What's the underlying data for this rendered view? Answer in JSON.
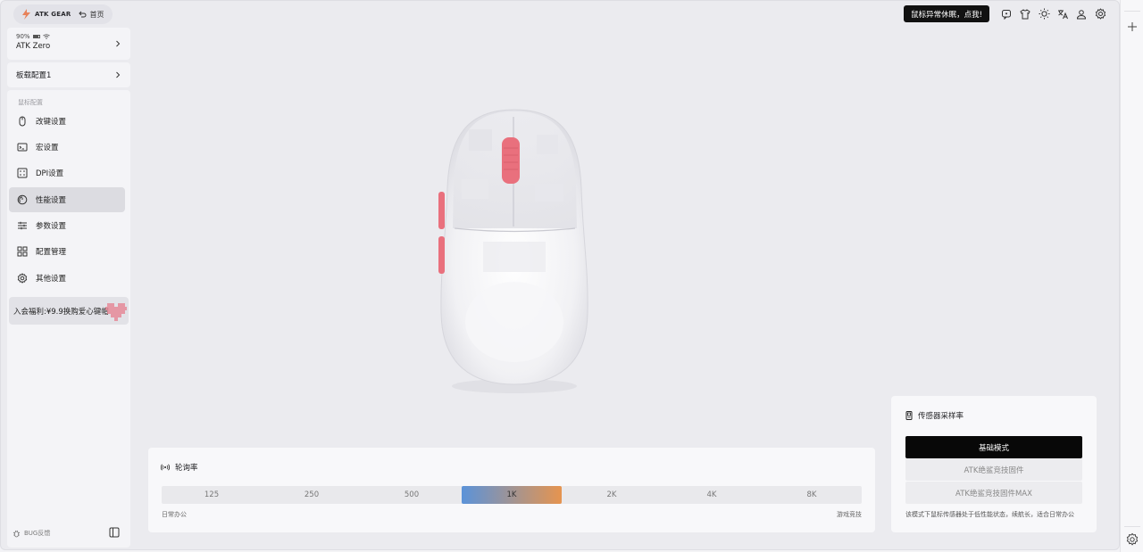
{
  "topbar": {
    "brand": "ATK GEAR",
    "home_label": "首页",
    "notice_button": "鼠标异常休眠，点我!",
    "icons": [
      "chat-icon",
      "shirt-icon",
      "theme-icon",
      "translate-icon",
      "user-icon",
      "settings-icon"
    ]
  },
  "sidebar": {
    "device": {
      "battery": "90%",
      "name": "ATK Zero"
    },
    "profile": "板载配置1",
    "section_label": "鼠标配置",
    "items": [
      {
        "label": "改键设置",
        "icon": "mouse-icon"
      },
      {
        "label": "宏设置",
        "icon": "terminal-icon"
      },
      {
        "label": "DPI设置",
        "icon": "dice-icon"
      },
      {
        "label": "性能设置",
        "icon": "gauge-icon",
        "active": true
      },
      {
        "label": "参数设置",
        "icon": "sliders-icon"
      },
      {
        "label": "配置管理",
        "icon": "grid-icon"
      },
      {
        "label": "其他设置",
        "icon": "gear-icon"
      }
    ],
    "promo": "入会福利:¥9.9换购爱心键帽",
    "bug_label": "BUG反馈"
  },
  "polling": {
    "title": "轮询率",
    "options": [
      "125",
      "250",
      "500",
      "1K",
      "2K",
      "4K",
      "8K"
    ],
    "selected": "1K",
    "left_caption": "日常办公",
    "right_caption": "游戏竞技"
  },
  "sensor": {
    "title": "传感器采样率",
    "modes": [
      "基础模式",
      "ATK绝鲨竞技固件",
      "ATK绝鲨竞技固件MAX"
    ],
    "active_mode": "基础模式",
    "description": "该模式下鼠标传感器处于低性能状态，续航长，适合日常办公"
  },
  "colors": {
    "accent_start": "#5b93d9",
    "accent_end": "#e6944f",
    "mouse_accent": "#e9707d"
  }
}
